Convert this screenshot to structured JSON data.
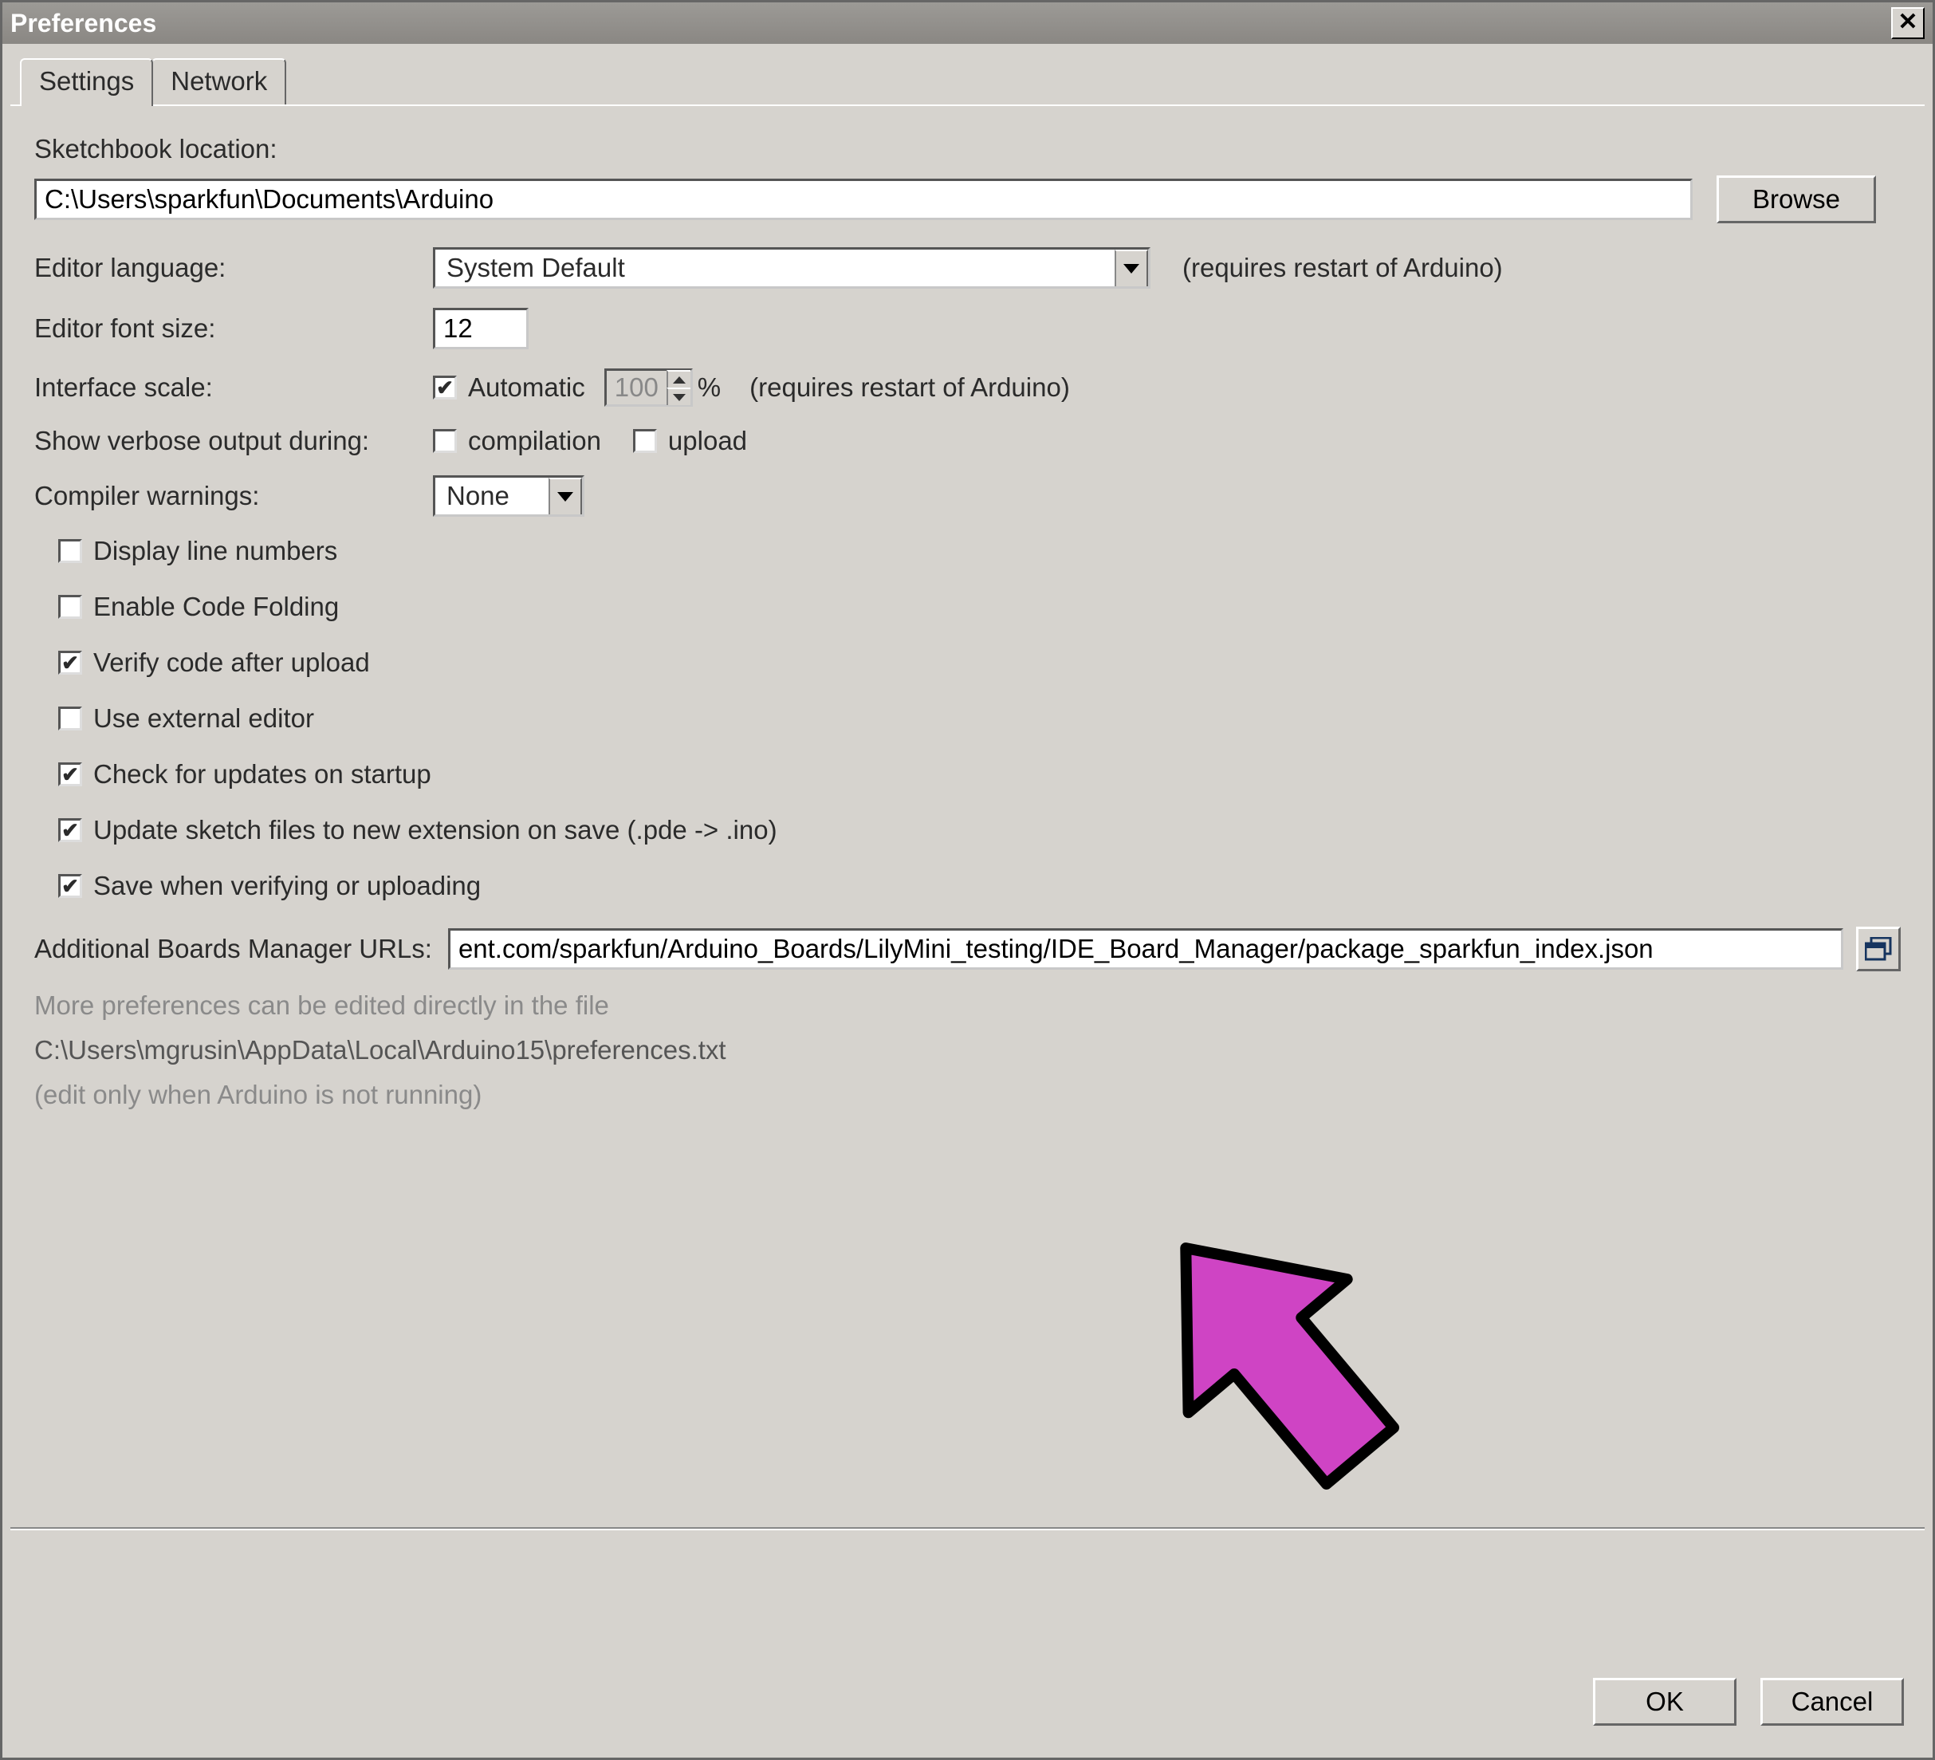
{
  "window": {
    "title": "Preferences"
  },
  "tabs": {
    "settings": "Settings",
    "network": "Network"
  },
  "sketchbook": {
    "label": "Sketchbook location:",
    "value": "C:\\Users\\sparkfun\\Documents\\Arduino",
    "browse": "Browse"
  },
  "language": {
    "label": "Editor language:",
    "value": "System Default",
    "note": "(requires restart of Arduino)"
  },
  "fontsize": {
    "label": "Editor font size:",
    "value": "12"
  },
  "scale": {
    "label": "Interface scale:",
    "auto": "Automatic",
    "value": "100",
    "pct": "%",
    "note": "(requires restart of Arduino)"
  },
  "verbose": {
    "label": "Show verbose output during:",
    "compilation": "compilation",
    "upload": "upload"
  },
  "compwarn": {
    "label": "Compiler warnings:",
    "value": "None"
  },
  "checks": {
    "line_numbers": "Display line numbers",
    "code_folding": "Enable Code Folding",
    "verify_upload": "Verify code after upload",
    "ext_editor": "Use external editor",
    "updates": "Check for updates on startup",
    "rename_ino": "Update sketch files to new extension on save (.pde -> .ino)",
    "save_verify": "Save when verifying or uploading"
  },
  "boards_url": {
    "label": "Additional Boards Manager URLs:",
    "value": "ent.com/sparkfun/Arduino_Boards/LilyMini_testing/IDE_Board_Manager/package_sparkfun_index.json"
  },
  "footer_notes": {
    "more": "More preferences can be edited directly in the file",
    "path": "C:\\Users\\mgrusin\\AppData\\Local\\Arduino15\\preferences.txt",
    "edit_only": "(edit only when Arduino is not running)"
  },
  "buttons": {
    "ok": "OK",
    "cancel": "Cancel"
  }
}
